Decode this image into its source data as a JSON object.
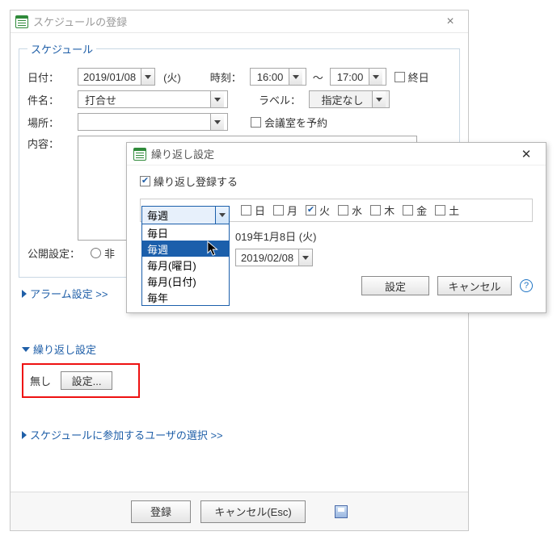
{
  "window": {
    "title": "スケジュールの登録",
    "section_legend": "スケジュール",
    "date_label": "日付：",
    "date_value": "2019/01/08",
    "date_dow": "(火)",
    "time_label": "時刻：",
    "time_from": "16:00",
    "time_to": "17:00",
    "allday_label": "終日",
    "subject_label": "件名：",
    "subject_value": "打合せ",
    "label_label": "ラベル：",
    "label_value": "指定なし",
    "place_label": "場所：",
    "reserve_room_label": "会議室を予約",
    "content_label": "内容：",
    "public_label": "公開設定：",
    "public_opt_partial": "非",
    "alarm_link": "アラーム設定 >>",
    "repeat_link": "繰り返し設定",
    "repeat_value": "無し",
    "repeat_button": "設定...",
    "users_link": "スケジュールに参加するユーザの選択 >>",
    "register_btn": "登録",
    "cancel_btn": "キャンセル(Esc)"
  },
  "dialog": {
    "title": "繰り返し設定",
    "enable_label": "繰り返し登録する",
    "freq_selected": "毎週",
    "days": [
      "日",
      "月",
      "火",
      "水",
      "木",
      "金",
      "土"
    ],
    "checked_day_index": 2,
    "start_text": "019年1月8日 (火)",
    "end_date": "2019/02/08",
    "ok_btn": "設定",
    "cancel_btn": "キャンセル",
    "dropdown_items": [
      "毎日",
      "毎週",
      "毎月(曜日)",
      "毎月(日付)",
      "毎年"
    ],
    "dropdown_highlight_index": 1
  }
}
